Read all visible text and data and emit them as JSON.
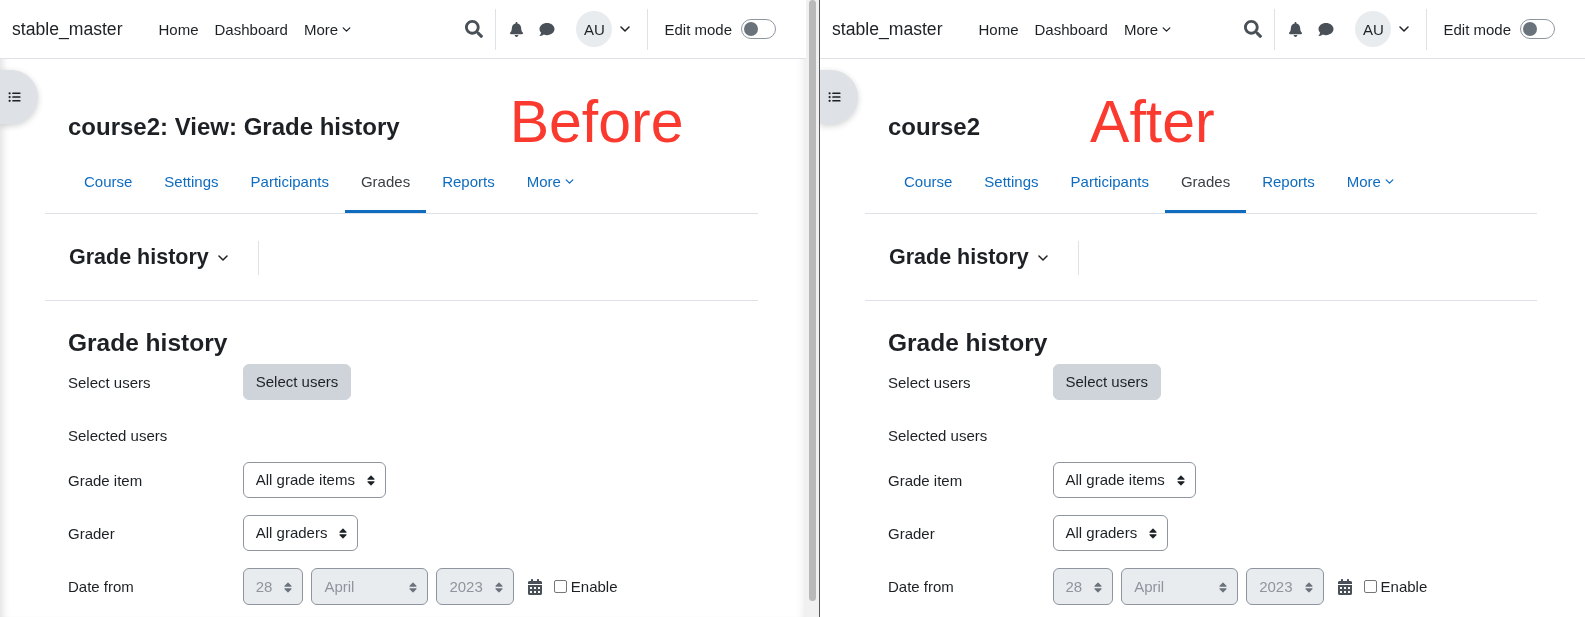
{
  "panels": [
    {
      "annotation": "Before",
      "navbar": {
        "brand": "stable_master",
        "links": [
          {
            "label": "Home",
            "kind": "link"
          },
          {
            "label": "Dashboard",
            "kind": "link"
          },
          {
            "label": "More",
            "kind": "menu"
          }
        ],
        "avatar": "AU",
        "edit_mode": {
          "label": "Edit mode",
          "on": false
        }
      },
      "page_title": "course2: View: Grade history",
      "tabs": [
        {
          "label": "Course",
          "kind": "link",
          "selected": false
        },
        {
          "label": "Settings",
          "kind": "link",
          "selected": false
        },
        {
          "label": "Participants",
          "kind": "link",
          "selected": false
        },
        {
          "label": "Grades",
          "kind": "link",
          "selected": true
        },
        {
          "label": "Reports",
          "kind": "link",
          "selected": false
        },
        {
          "label": "More",
          "kind": "menu",
          "selected": false
        }
      ],
      "report_selector": "Grade history",
      "form": {
        "heading": "Grade history",
        "rows": [
          {
            "label": "Select users",
            "kind": "button",
            "button": "Select users"
          },
          {
            "label": "Selected users",
            "kind": "static"
          },
          {
            "label": "Grade item",
            "kind": "select",
            "selects": [
              {
                "value": "All grade items",
                "disabled": false
              }
            ]
          },
          {
            "label": "Grader",
            "kind": "select",
            "selects": [
              {
                "value": "All graders",
                "disabled": false
              }
            ]
          },
          {
            "label": "Date from",
            "kind": "date",
            "selects": [
              {
                "value": "28",
                "disabled": true
              },
              {
                "value": "April",
                "disabled": true
              },
              {
                "value": "2023",
                "disabled": true
              }
            ],
            "checkbox": {
              "label": "Enable",
              "checked": false
            }
          }
        ]
      }
    },
    {
      "annotation": "After",
      "navbar": {
        "brand": "stable_master",
        "links": [
          {
            "label": "Home",
            "kind": "link"
          },
          {
            "label": "Dashboard",
            "kind": "link"
          },
          {
            "label": "More",
            "kind": "menu"
          }
        ],
        "avatar": "AU",
        "edit_mode": {
          "label": "Edit mode",
          "on": false
        }
      },
      "page_title": "course2",
      "tabs": [
        {
          "label": "Course",
          "kind": "link",
          "selected": false
        },
        {
          "label": "Settings",
          "kind": "link",
          "selected": false
        },
        {
          "label": "Participants",
          "kind": "link",
          "selected": false
        },
        {
          "label": "Grades",
          "kind": "link",
          "selected": true
        },
        {
          "label": "Reports",
          "kind": "link",
          "selected": false
        },
        {
          "label": "More",
          "kind": "menu",
          "selected": false
        }
      ],
      "report_selector": "Grade history",
      "form": {
        "heading": "Grade history",
        "rows": [
          {
            "label": "Select users",
            "kind": "button",
            "button": "Select users"
          },
          {
            "label": "Selected users",
            "kind": "static"
          },
          {
            "label": "Grade item",
            "kind": "select",
            "selects": [
              {
                "value": "All grade items",
                "disabled": false
              }
            ]
          },
          {
            "label": "Grader",
            "kind": "select",
            "selects": [
              {
                "value": "All graders",
                "disabled": false
              }
            ]
          },
          {
            "label": "Date from",
            "kind": "date",
            "selects": [
              {
                "value": "28",
                "disabled": true
              },
              {
                "value": "April",
                "disabled": true
              },
              {
                "value": "2023",
                "disabled": true
              }
            ],
            "checkbox": {
              "label": "Enable",
              "checked": false
            }
          }
        ]
      }
    }
  ]
}
